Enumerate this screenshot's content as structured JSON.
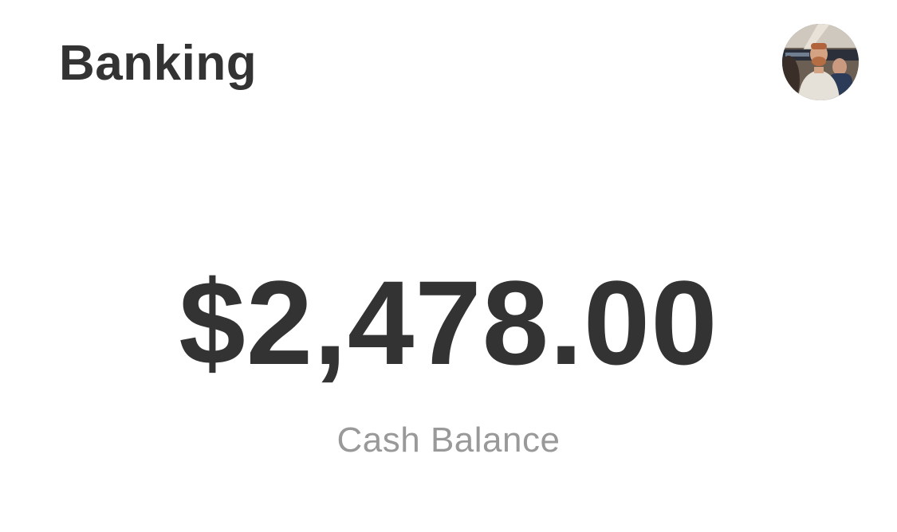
{
  "header": {
    "title": "Banking",
    "avatar_icon": "profile-photo-icon"
  },
  "balance": {
    "amount": "$2,478.00",
    "label": "Cash Balance"
  },
  "colors": {
    "text_primary": "#333333",
    "text_secondary": "#999999",
    "background": "#ffffff"
  }
}
